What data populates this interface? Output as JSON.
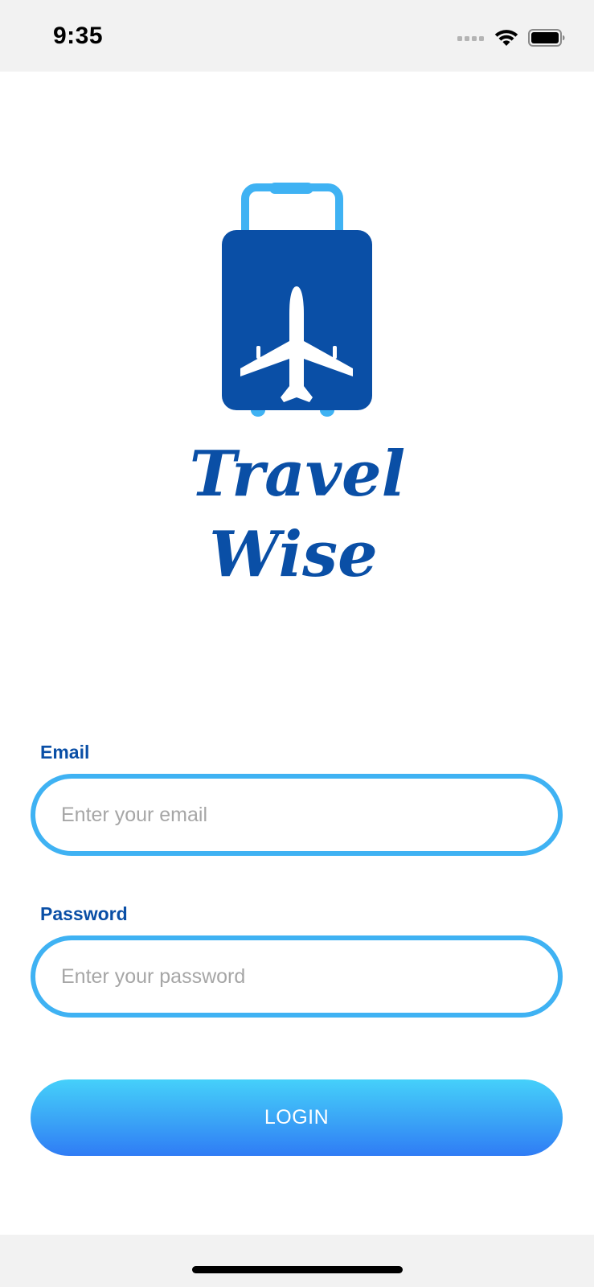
{
  "status_bar": {
    "time": "9:35"
  },
  "logo": {
    "line1": "Travel",
    "line2": "Wise",
    "icon": "suitcase-airplane-icon",
    "brand_color": "#0a4fa6",
    "accent_color": "#3fb2f3"
  },
  "form": {
    "email_label": "Email",
    "email_placeholder": "Enter your email",
    "email_value": "",
    "password_label": "Password",
    "password_placeholder": "Enter your password",
    "password_value": ""
  },
  "login_button": {
    "label": "LOGIN"
  },
  "colors": {
    "input_border": "#3fb2f3",
    "button_top": "#45d0fa",
    "button_bottom": "#2f7cf5",
    "label": "#0a4fa6"
  }
}
